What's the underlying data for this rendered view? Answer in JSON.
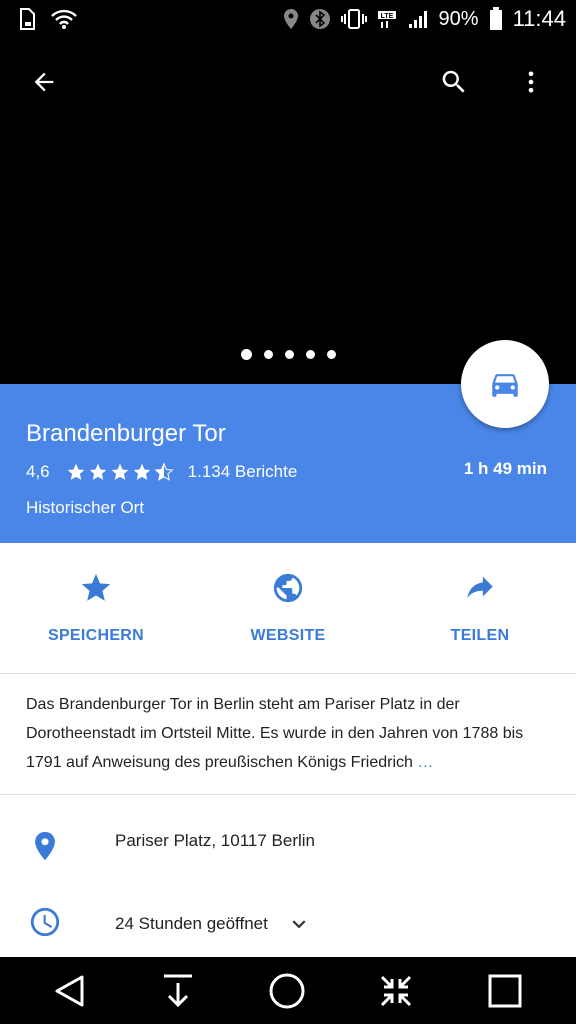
{
  "status_bar": {
    "battery": "90%",
    "time": "11:44",
    "icons": [
      "sim-icon",
      "wifi-icon",
      "location-icon",
      "bluetooth-icon",
      "vibrate-icon",
      "lte-icon",
      "signal-icon",
      "battery-icon"
    ]
  },
  "toolbar": {
    "icons": [
      "back-arrow-icon",
      "search-icon",
      "more-vert-icon"
    ]
  },
  "gallery": {
    "dot_count": 5,
    "active_index": 0
  },
  "place": {
    "name": "Brandenburger Tor",
    "rating": "4,6",
    "rating_value": 4.6,
    "reviews": "1.134 Berichte",
    "category": "Historischer Ort",
    "eta": "1 h 49 min"
  },
  "actions": [
    {
      "label": "SPEICHERN",
      "icon": "star-icon"
    },
    {
      "label": "WEBSITE",
      "icon": "globe-icon"
    },
    {
      "label": "TEILEN",
      "icon": "share-icon"
    }
  ],
  "description": {
    "text": "Das Brandenburger Tor in Berlin steht am Pariser Platz in der Dorotheenstadt im Ortsteil Mitte. Es wurde in den Jahren von 1788 bis 1791 auf Anweisung des preußischen Königs Friedrich",
    "more": "…"
  },
  "details": {
    "address": "Pariser Platz, 10117 Berlin",
    "hours": "24 Stunden geöffnet"
  },
  "colors": {
    "accent": "#4a86e8",
    "link": "#3a7bd5"
  }
}
